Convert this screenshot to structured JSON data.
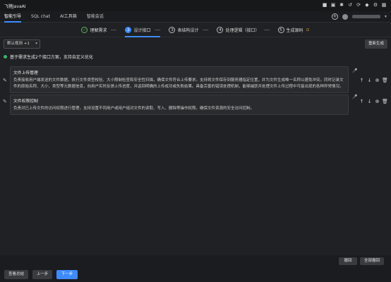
{
  "app": {
    "title": "飞猪JavaAI"
  },
  "nav": {
    "tabs": [
      "智能引导",
      "SQL chat",
      "AI工具箱",
      "智能会话"
    ]
  },
  "steps": [
    {
      "label": "理解需求",
      "num": "✓"
    },
    {
      "label": "设计接口",
      "num": "2"
    },
    {
      "label": "表结构设计",
      "num": "3"
    },
    {
      "label": "处理逻辑（接口）",
      "num": "4"
    },
    {
      "label": "生成源码",
      "num": "5"
    }
  ],
  "toolbar": {
    "select_value": "默认规则 +1",
    "regen_label": "重新生成"
  },
  "hint": {
    "text": "基于需求生成2个接口方案，支持自定义优化"
  },
  "cards": [
    {
      "title": "文件上传管理",
      "desc": "负责接收用户端发送的文件数据，执行文件类型校验、大小限制检查和安全性扫描，确保文件符合上传要求。支持将文件保存到服务器指定位置，并为文件生成唯一名称以避免冲突。同时记录文件的原始名称、大小、类型等元数据信息，向用户实时反馈上传进度，并返回明确的上传成功或失败结果。具备完善的错误处理机制，能够捕获并处理文件上传过程中可能出现的各种异常情况。"
    },
    {
      "title": "文件权限控制",
      "desc": "负责对已上传文件的访问权限进行管理，支持设置不同用户或用户组对文件的读取、写入、删除等操作权限，确保文件资源的安全访问控制。"
    }
  ],
  "bottom": {
    "undo_label": "撤回",
    "undo_all_label": "全部撤回"
  },
  "footer": {
    "view_summary": "查看总结",
    "prev": "上一步",
    "next": "下一步"
  },
  "colors": {
    "accent": "#3d8bff",
    "success": "#3cb371",
    "warn": "#e3a33a"
  }
}
